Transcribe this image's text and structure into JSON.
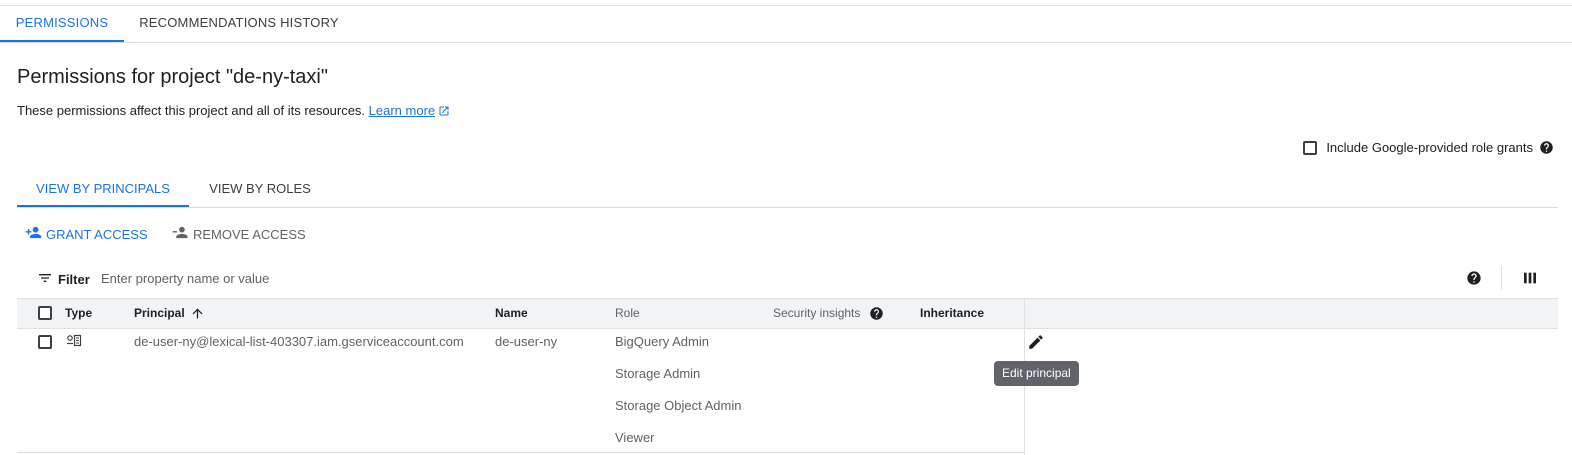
{
  "top_tabs": [
    {
      "label": "PERMISSIONS",
      "active": true
    },
    {
      "label": "RECOMMENDATIONS HISTORY",
      "active": false
    }
  ],
  "page": {
    "title": "Permissions for project \"de-ny-taxi\"",
    "subtitle": "These permissions affect this project and all of its resources.",
    "learn_more": "Learn more"
  },
  "include_google_grants": {
    "label": "Include Google-provided role grants",
    "checked": false
  },
  "view_tabs": [
    {
      "label": "VIEW BY PRINCIPALS",
      "active": true
    },
    {
      "label": "VIEW BY ROLES",
      "active": false
    }
  ],
  "actions": {
    "grant": "GRANT ACCESS",
    "remove": "REMOVE ACCESS"
  },
  "filter": {
    "label": "Filter",
    "placeholder": "Enter property name or value"
  },
  "table": {
    "headers": {
      "type": "Type",
      "principal": "Principal",
      "name": "Name",
      "role": "Role",
      "security_insights": "Security insights",
      "inheritance": "Inheritance"
    },
    "rows": [
      {
        "principal": "de-user-ny@lexical-list-403307.iam.gserviceaccount.com",
        "name": "de-user-ny",
        "roles": [
          "BigQuery Admin",
          "Storage Admin",
          "Storage Object Admin",
          "Viewer"
        ]
      }
    ]
  },
  "tooltip": "Edit principal",
  "colors": {
    "accent": "#1a73e8",
    "text": "#202124",
    "muted": "#5f6368",
    "header_bg": "#f1f3f4",
    "tooltip_bg": "#606368"
  },
  "icons": {
    "external_link": "external-link-icon",
    "help": "help-icon",
    "grant": "person-add-icon",
    "remove": "person-remove-icon",
    "filter": "filter-icon",
    "columns": "column-display-icon",
    "sort": "arrow-up-icon",
    "service_account": "service-account-icon",
    "edit": "pencil-icon"
  }
}
